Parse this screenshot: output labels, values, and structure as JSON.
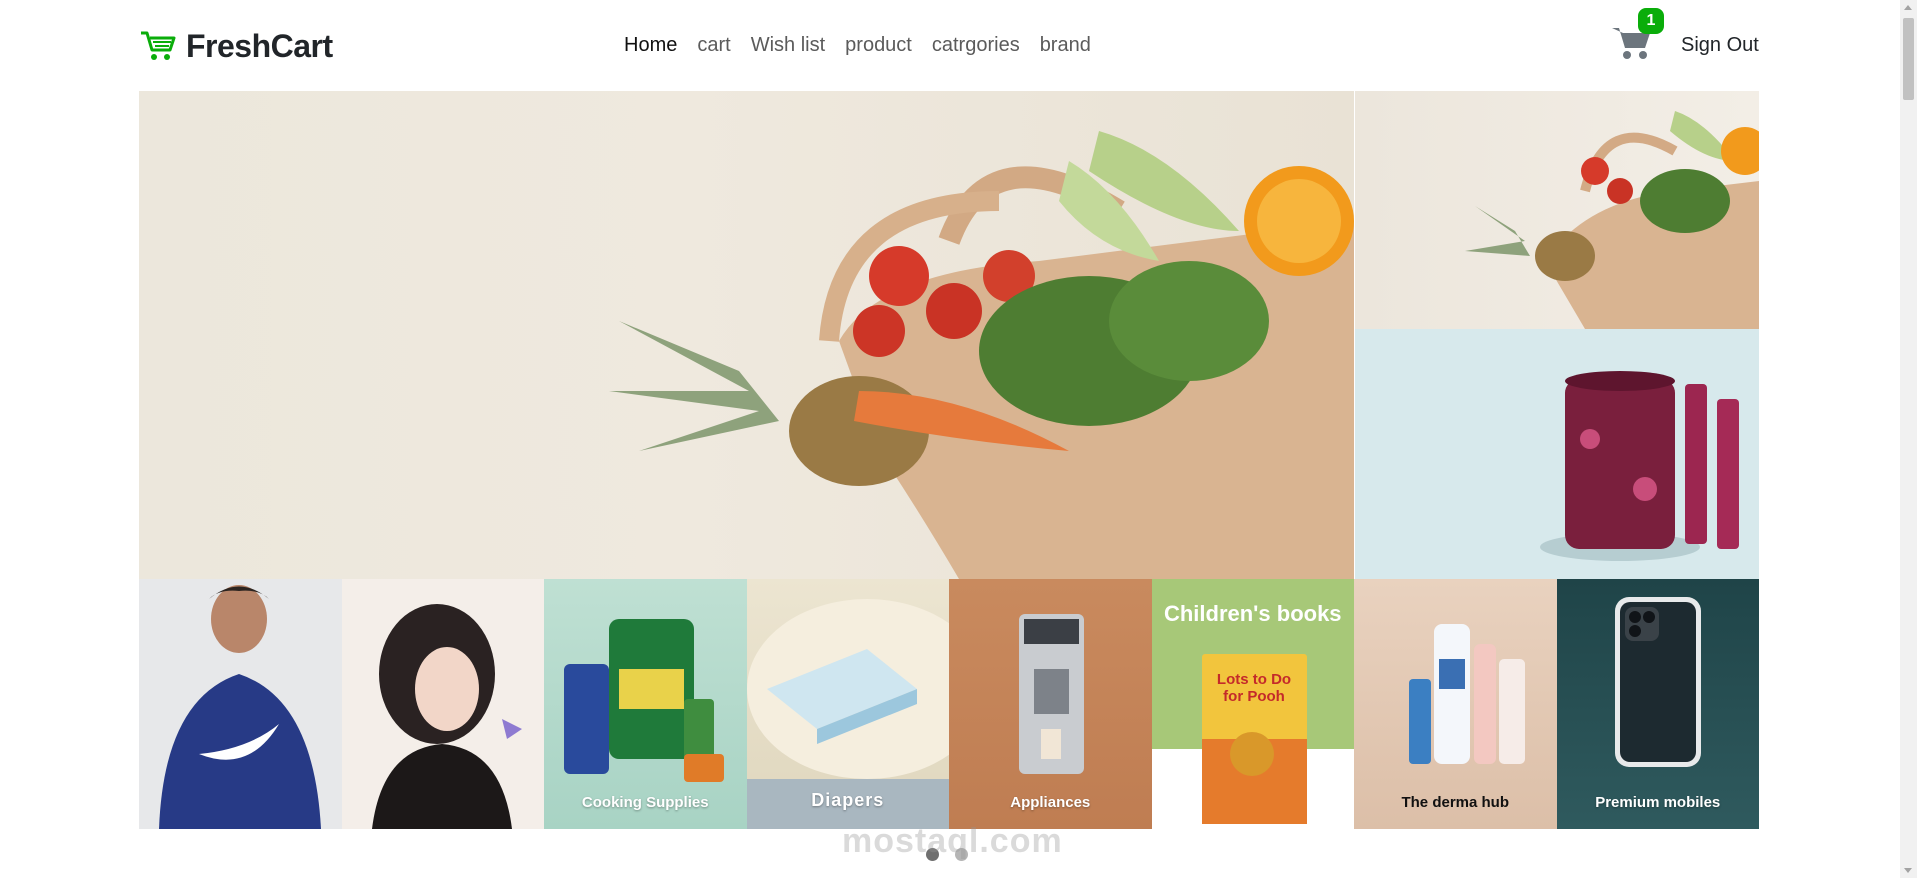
{
  "brand": {
    "name": "FreshCart"
  },
  "nav": {
    "links": [
      {
        "label": "Home",
        "active": true
      },
      {
        "label": "cart"
      },
      {
        "label": "Wish list"
      },
      {
        "label": "product"
      },
      {
        "label": "catrgories"
      },
      {
        "label": "brand"
      }
    ]
  },
  "cart": {
    "count": "1"
  },
  "auth": {
    "signout_label": "Sign Out"
  },
  "categories": [
    {
      "caption": ""
    },
    {
      "caption": ""
    },
    {
      "caption": "Cooking Supplies"
    },
    {
      "caption": "Diapers"
    },
    {
      "caption": "Appliances"
    },
    {
      "caption": "Children's books",
      "book_title": "Lots to Do for Pooh"
    },
    {
      "caption": "The derma hub"
    },
    {
      "caption": "Premium mobiles"
    }
  ],
  "slider": {
    "active_index": 0,
    "dots": 2
  },
  "watermark": "mostaql.com",
  "colors": {
    "brand_green": "#0aad0a",
    "text_dark": "#212529",
    "nav_gray": "#5b5b5b"
  }
}
